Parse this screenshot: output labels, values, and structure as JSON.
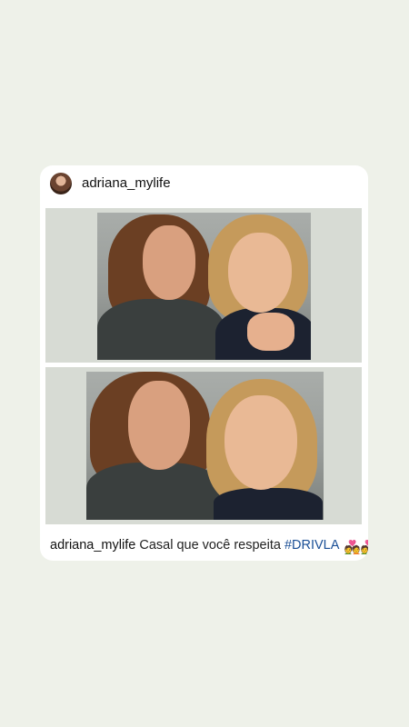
{
  "post": {
    "header": {
      "username": "adriana_mylife"
    },
    "caption": {
      "username": "adriana_mylife",
      "text": "Casal que você respeita",
      "hashtag": "#DRIVLA",
      "emoji": "💑💑"
    }
  }
}
